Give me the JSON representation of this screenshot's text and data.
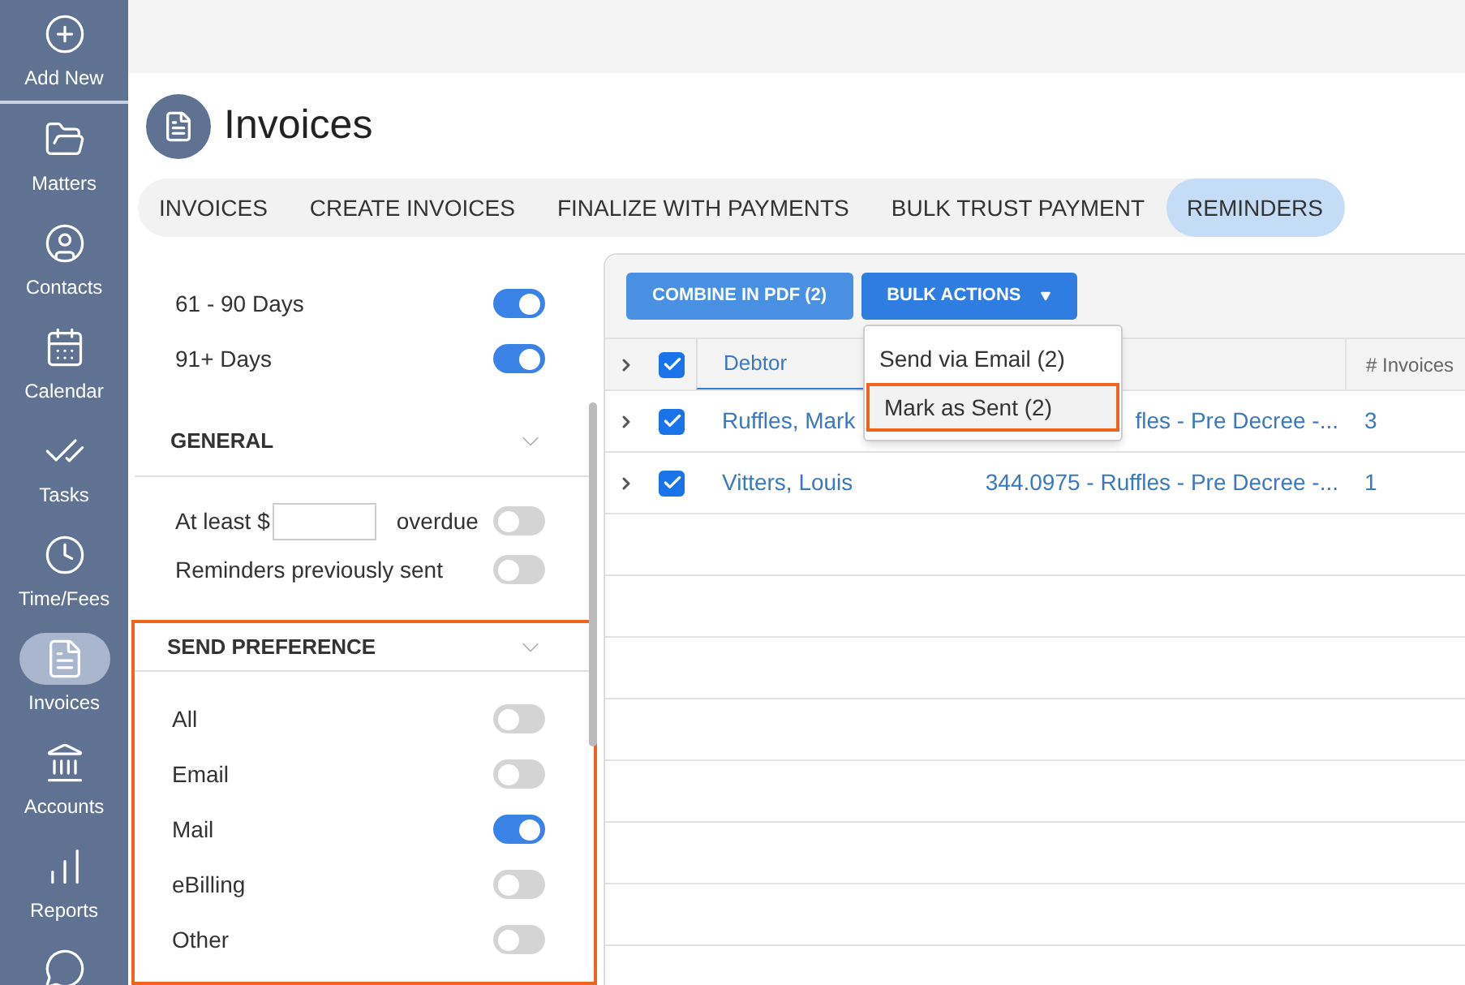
{
  "sidebar": {
    "items": [
      {
        "label": "Add New",
        "selected": false
      },
      {
        "label": "Matters",
        "selected": false
      },
      {
        "label": "Contacts",
        "selected": false
      },
      {
        "label": "Calendar",
        "selected": false
      },
      {
        "label": "Tasks",
        "selected": false
      },
      {
        "label": "Time/Fees",
        "selected": false
      },
      {
        "label": "Invoices",
        "selected": true
      },
      {
        "label": "Accounts",
        "selected": false
      },
      {
        "label": "Reports",
        "selected": false
      }
    ]
  },
  "page": {
    "title": "Invoices"
  },
  "tabs": [
    {
      "label": "INVOICES",
      "selected": false
    },
    {
      "label": "CREATE INVOICES",
      "selected": false
    },
    {
      "label": "FINALIZE WITH PAYMENTS",
      "selected": false
    },
    {
      "label": "BULK TRUST PAYMENT",
      "selected": false
    },
    {
      "label": "REMINDERS",
      "selected": true
    }
  ],
  "filters": {
    "age_rows": [
      {
        "label": "61 - 90 Days",
        "on": true
      },
      {
        "label": "91+ Days",
        "on": true
      }
    ],
    "general": {
      "title": "GENERAL",
      "amount_prefix": "At least $",
      "amount_suffix": "overdue",
      "amount_on": false,
      "previously_sent": {
        "label": "Reminders previously sent",
        "on": false
      }
    },
    "send_preference": {
      "title": "SEND PREFERENCE",
      "highlighted": true,
      "rows": [
        {
          "label": "All",
          "on": false
        },
        {
          "label": "Email",
          "on": false
        },
        {
          "label": "Mail",
          "on": true
        },
        {
          "label": "eBilling",
          "on": false
        },
        {
          "label": "Other",
          "on": false
        }
      ]
    }
  },
  "toolbar": {
    "buttons": [
      "COMBINE IN PDF (2)",
      "BULK ACTIONS"
    ]
  },
  "menu": {
    "items": [
      {
        "label": "Send via Email (2)",
        "selected": false,
        "highlighted": false
      },
      {
        "label": "Mark as Sent (2)",
        "selected": true,
        "highlighted": true
      }
    ]
  },
  "table": {
    "all_checked": true,
    "columns": [
      "Debtor",
      "# Invoices"
    ],
    "rows": [
      {
        "checked": true,
        "debtor": "Ruffles, Mark",
        "column_2": "fles - Pre Decree -...",
        "invoices": "3"
      },
      {
        "checked": true,
        "debtor": "Vitters, Louis",
        "column_2": "344.0975 - Ruffles - Pre Decree -...",
        "invoices": "1"
      }
    ]
  }
}
